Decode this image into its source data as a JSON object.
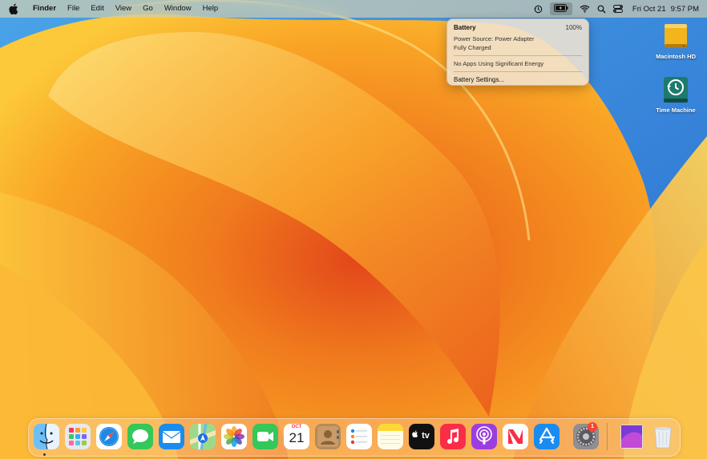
{
  "menubar": {
    "app_name": "Finder",
    "menus": [
      "File",
      "Edit",
      "View",
      "Go",
      "Window",
      "Help"
    ],
    "clock_date": "Fri Oct 21",
    "clock_time": "9:57 PM",
    "status_icons": [
      "time-machine-icon",
      "battery-icon",
      "wifi-icon",
      "search-icon",
      "control-center-icon"
    ]
  },
  "battery_popover": {
    "title": "Battery",
    "percent": "100%",
    "power_source": "Power Source: Power Adapter",
    "status": "Fully Charged",
    "energy_note": "No Apps Using Significant Energy",
    "settings_label": "Battery Settings..."
  },
  "desktop_icons": [
    {
      "label": "Macintosh HD",
      "icon": "hard-drive-icon"
    },
    {
      "label": "Time Machine",
      "icon": "time-machine-disk-icon"
    }
  ],
  "dock": {
    "apps": [
      "Finder",
      "Launchpad",
      "Safari",
      "Messages",
      "Mail",
      "Maps",
      "Photos",
      "FaceTime",
      "Calendar",
      "Contacts",
      "Reminders",
      "Notes",
      "TV",
      "Music",
      "Podcasts",
      "News",
      "App Store",
      "System Settings"
    ],
    "calendar_month": "OCT",
    "calendar_day": "21",
    "tv_label": "tv",
    "settings_badge": "1",
    "trailing": [
      "Downloads",
      "Trash"
    ]
  }
}
